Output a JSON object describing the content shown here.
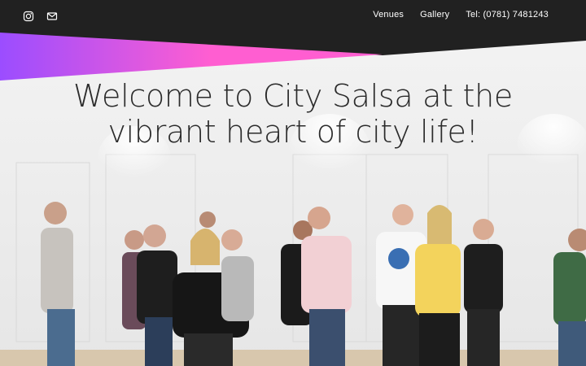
{
  "header": {
    "social": [
      {
        "icon": "instagram-icon"
      },
      {
        "icon": "envelope-icon"
      }
    ],
    "nav": [
      {
        "label": "Venues"
      },
      {
        "label": "Gallery"
      },
      {
        "label": "Tel: (0781) 7481243"
      }
    ]
  },
  "hero": {
    "line1": "Welcome to City Salsa at the",
    "line2": "vibrant heart of city life!",
    "gradient": [
      "#9b4dff",
      "#ff5ed1"
    ]
  },
  "colors": {
    "topbar": "#212121",
    "wall": "#efefef"
  }
}
